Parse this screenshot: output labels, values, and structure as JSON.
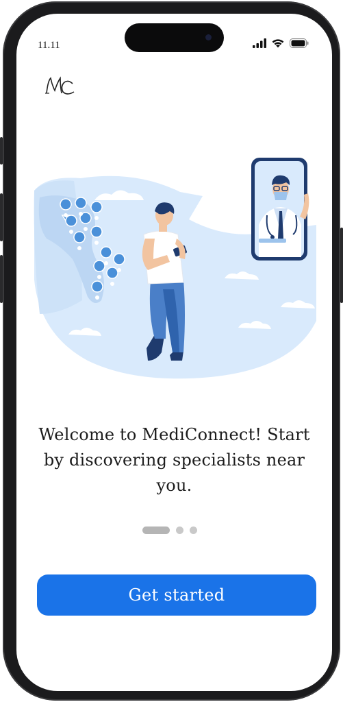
{
  "status_bar": {
    "time": "11.11",
    "signal_icon": "cellular-signal-icon",
    "wifi_icon": "wifi-icon",
    "battery_icon": "battery-icon"
  },
  "logo": {
    "text": "MC"
  },
  "illustration": {
    "name": "person-with-phone-and-doctor-video-call"
  },
  "onboarding": {
    "message": "Welcome to MediConnect! Start by discovering specialists near you.",
    "page_indicator": {
      "current": 1,
      "total": 3
    }
  },
  "cta": {
    "label": "Get started"
  },
  "colors": {
    "primary": "#1a73e8",
    "map_blue": "#d6e8fb",
    "pin_blue": "#4a90d9",
    "dark_navy": "#1f3b6e"
  }
}
